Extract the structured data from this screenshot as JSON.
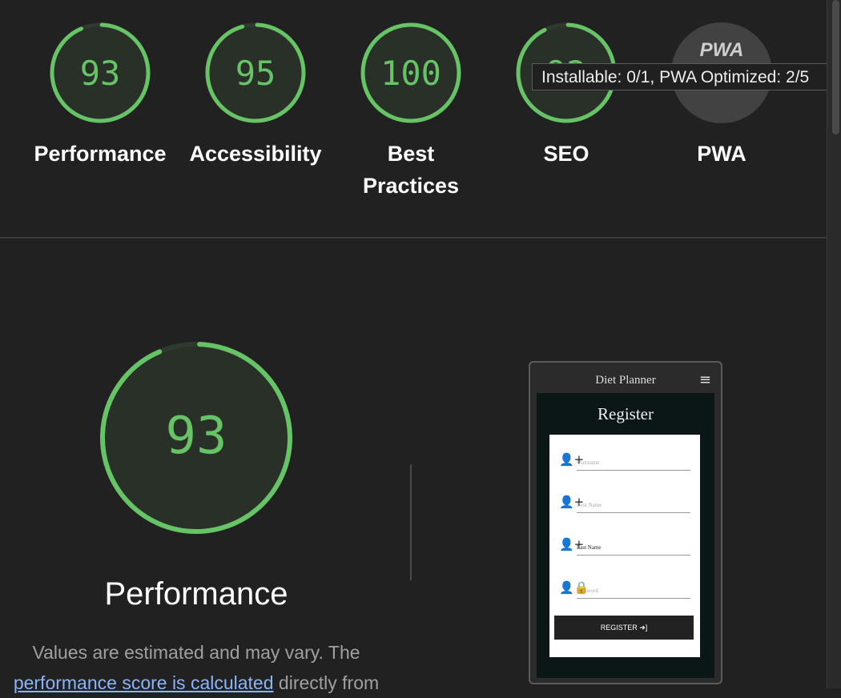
{
  "gauges": [
    {
      "label": "Performance",
      "score": "93",
      "value": 0.93
    },
    {
      "label": "Accessibility",
      "score": "95",
      "value": 0.95
    },
    {
      "label": "Best Practices",
      "score": "100",
      "value": 1.0
    },
    {
      "label": "SEO",
      "score": "92",
      "value": 0.92
    },
    {
      "label": "PWA",
      "score": "",
      "value": 0
    }
  ],
  "pwa_logo": "PWA",
  "tooltip": "Installable: 0/1, PWA Optimized: 2/5",
  "performance": {
    "score": "93",
    "value": 0.93,
    "title": "Performance",
    "desc_line1": "Values are estimated and may vary. The",
    "desc_link": "performance score is calculated",
    "desc_after": "directly from"
  },
  "screenshot": {
    "app_title": "Diet Planner",
    "menu_icon": "≡",
    "register_title": "Register",
    "fields": [
      {
        "icon": "user-plus-icon",
        "placeholder": "Username",
        "filled": false
      },
      {
        "icon": "user-plus-icon",
        "placeholder": "First Name",
        "filled": false
      },
      {
        "icon": "user-plus-icon",
        "placeholder": "Last Name",
        "filled": true
      },
      {
        "icon": "user-lock-icon",
        "placeholder": "Password",
        "filled": false
      }
    ],
    "register_button": "REGISTER ➜]"
  },
  "colors": {
    "pass": "#66c366",
    "bg": "#212121",
    "pwa_gray": "#424242"
  }
}
